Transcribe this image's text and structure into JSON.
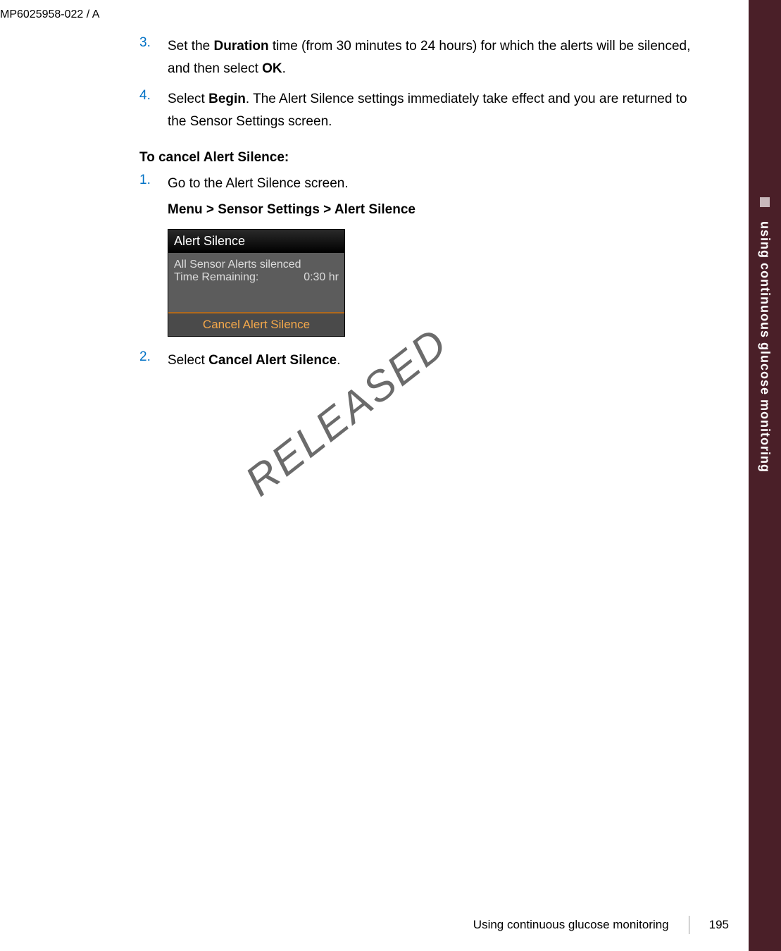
{
  "doc_id": "MP6025958-022 / A",
  "side_tab": {
    "label": "using continuous glucose monitoring"
  },
  "steps_a": [
    {
      "num": "3.",
      "pre": "Set the ",
      "bold1": "Duration",
      "mid": " time (from 30 minutes to 24 hours) for which the alerts will be silenced, and then select ",
      "bold2": "OK",
      "post": "."
    },
    {
      "num": "4.",
      "pre": "Select ",
      "bold1": "Begin",
      "mid": ". The Alert Silence settings immediately take effect and you are returned to the Sensor Settings screen.",
      "bold2": "",
      "post": ""
    }
  ],
  "cancel_heading": "To cancel Alert Silence:",
  "steps_b": [
    {
      "num": "1.",
      "text": "Go to the Alert Silence screen."
    }
  ],
  "breadcrumb": "Menu > Sensor Settings > Alert Silence",
  "device": {
    "title": "Alert Silence",
    "line1": "All Sensor Alerts silenced",
    "time_label": "Time Remaining:",
    "time_value": "0:30 hr",
    "cancel_btn": "Cancel Alert Silence"
  },
  "steps_c": [
    {
      "num": "2.",
      "pre": "Select ",
      "bold": "Cancel Alert Silence",
      "post": "."
    }
  ],
  "watermark": "RELEASED",
  "footer": {
    "chapter": "Using continuous glucose monitoring",
    "page": "195"
  }
}
